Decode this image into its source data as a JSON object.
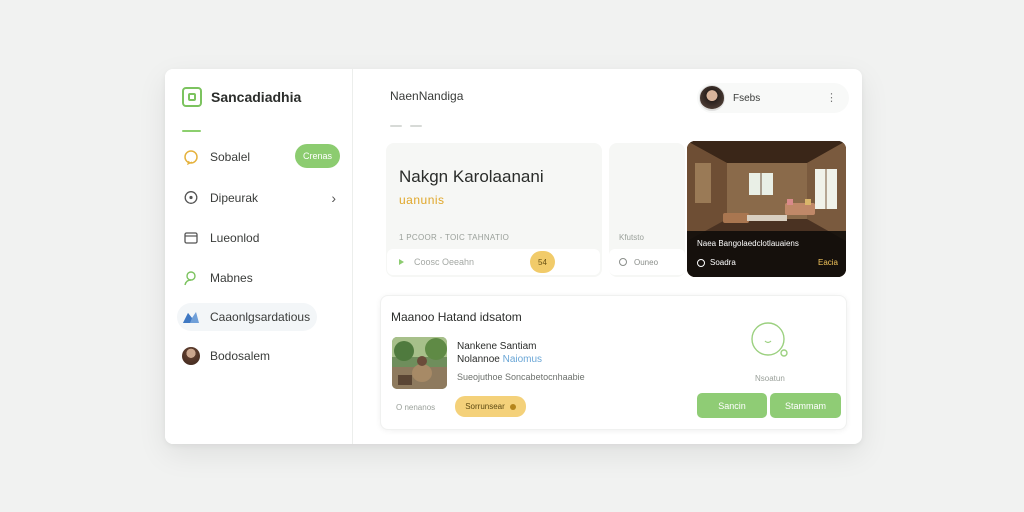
{
  "brand": {
    "name": "Sancadiadhia"
  },
  "sidebar": {
    "items": [
      {
        "label": "Sobalel",
        "badge": "Crenas"
      },
      {
        "label": "Dipeurak"
      },
      {
        "label": "Lueonlod"
      },
      {
        "label": "Mabnes"
      },
      {
        "label": "Caaonlgsardatious"
      },
      {
        "label": "Bodosalem"
      }
    ]
  },
  "header": {
    "title": "NaenNandiga",
    "user_name": "Fsebs"
  },
  "hero": {
    "title": "Nakgn Karolaanani",
    "subtitle": "uanunis",
    "meta": "1 PCOOR - TOIC TAHNATIO",
    "bar_label": "Coosc Oeeahn",
    "badge": "54"
  },
  "mid_card": {
    "meta": "Kfutsto",
    "bar_label": "Ouneo"
  },
  "photo_card": {
    "caption": "Naea Bangolaedclotlauaiens",
    "foot": "Soadra",
    "tag": "Eacia"
  },
  "bottom": {
    "title": "Maanoo Hatand idsatom",
    "item_name": "Nankene Santiam",
    "item_sub_a": "Nolannoe ",
    "item_sub_b": "Naiomus",
    "item_desc": "Sueojuthoe Soncabetocnhaabie",
    "count": "O nenanos",
    "pill": "Sorrunsear",
    "ring_label": "Nsoatun",
    "btn_1": "Sancin",
    "btn_2": "Stammam"
  },
  "colors": {
    "accent_green": "#8ccc70",
    "accent_gold": "#f1cb6a"
  }
}
